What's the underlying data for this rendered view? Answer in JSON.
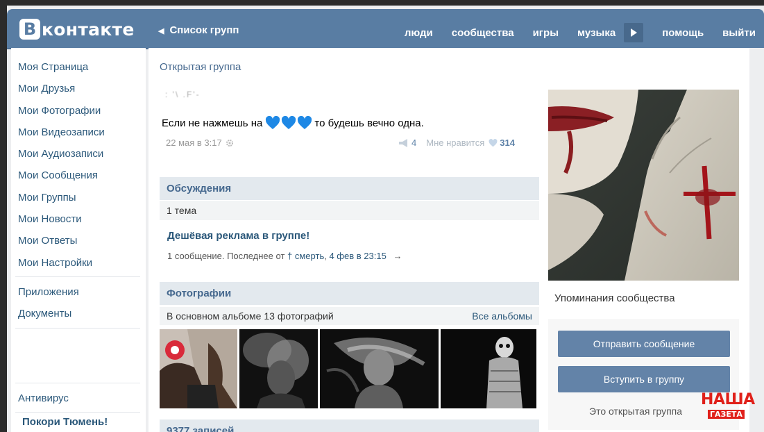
{
  "header": {
    "logo_letter": "В",
    "logo_text": "контакте",
    "back_label": "Список групп",
    "nav": [
      "люди",
      "сообщества",
      "игры",
      "музыка",
      "помощь",
      "выйти"
    ]
  },
  "sidebar": {
    "items": [
      "Моя Страница",
      "Мои Друзья",
      "Мои Фотографии",
      "Мои Видеозаписи",
      "Мои Аудиозаписи",
      "Мои Сообщения",
      "Мои Группы",
      "Мои Новости",
      "Мои Ответы",
      "Мои Настройки"
    ],
    "extra": [
      "Приложения",
      "Документы"
    ],
    "antivirus": "Антивирус",
    "promo": "Покори Тюмень!"
  },
  "group": {
    "type": "Открытая группа",
    "status_blurred": ": '\\ .F'-",
    "post_text_before": "Если не нажмешь на",
    "post_text_after": "то будешь вечно одна.",
    "post_date": "22 мая в 3:17",
    "repost_count": "4",
    "like_label": "Мне нравится",
    "like_count": "314"
  },
  "discussions": {
    "title": "Обсуждения",
    "count": "1 тема",
    "topic_title": "Дешёвая реклама в группе!",
    "topic_meta_prefix": "1 сообщение. Последнее от",
    "topic_meta_author": "† смерть",
    "topic_meta_time": "4 фев в 23:15",
    "arrow": "→"
  },
  "photos": {
    "title": "Фотографии",
    "album_count": "В основном альбоме 13 фотографий",
    "all_albums": "Все альбомы"
  },
  "posts": {
    "count": "9377 записей"
  },
  "right": {
    "mentions": "Упоминания сообщества",
    "send_message": "Отправить сообщение",
    "join_group": "Вступить в группу",
    "open_note": "Это открытая группа"
  },
  "watermark": {
    "top": "НАША",
    "bottom": "ГАЗЕТА"
  },
  "colors": {
    "header": "#597da3",
    "link": "#2b587a",
    "button": "#6383a8",
    "heart": "#1e88e5"
  }
}
